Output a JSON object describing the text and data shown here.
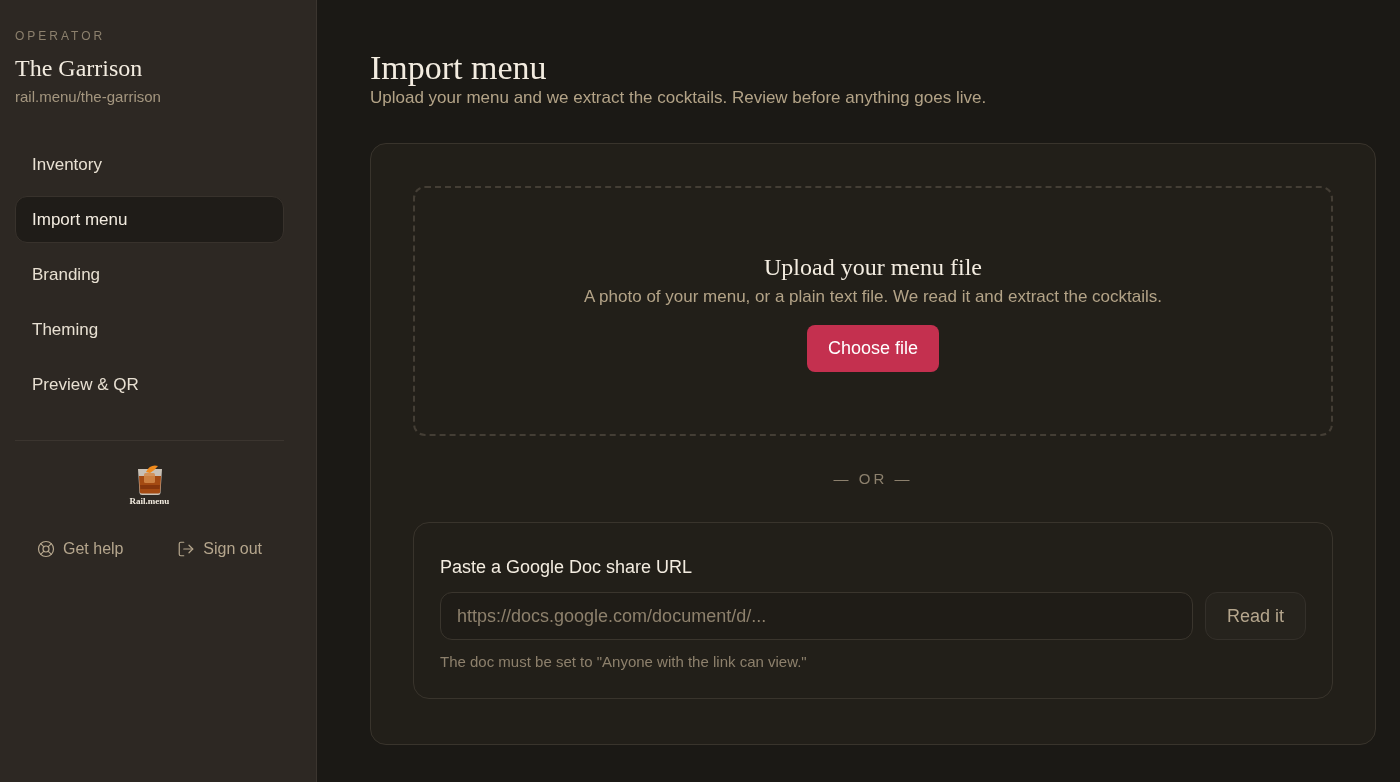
{
  "sidebar": {
    "eyebrow": "OPERATOR",
    "venue_name": "The Garrison",
    "venue_url": "rail.menu/the-garrison",
    "nav_items": [
      {
        "label": "Inventory",
        "selected": false
      },
      {
        "label": "Import menu",
        "selected": true
      },
      {
        "label": "Branding",
        "selected": false
      },
      {
        "label": "Theming",
        "selected": false
      },
      {
        "label": "Preview & QR",
        "selected": false
      }
    ],
    "logo_text": "Rail.menu",
    "footer_links": [
      {
        "label": "Get help",
        "kind": "help"
      },
      {
        "label": "Sign out",
        "kind": "sign_out"
      }
    ]
  },
  "page": {
    "title": "Import menu",
    "subtitle": "Upload your menu and we extract the cocktails. Review before anything goes live."
  },
  "upload": {
    "title": "Upload your menu file",
    "description": "A photo of your menu, or a plain text file. We read it and extract the cocktails.",
    "button": "Choose file"
  },
  "separator": "— OR —",
  "google_doc": {
    "label": "Paste a Google Doc share URL",
    "placeholder": "https://docs.google.com/document/d/...",
    "button": "Read it",
    "hint": "The doc must be set to \"Anyone with the link can view.\""
  }
}
